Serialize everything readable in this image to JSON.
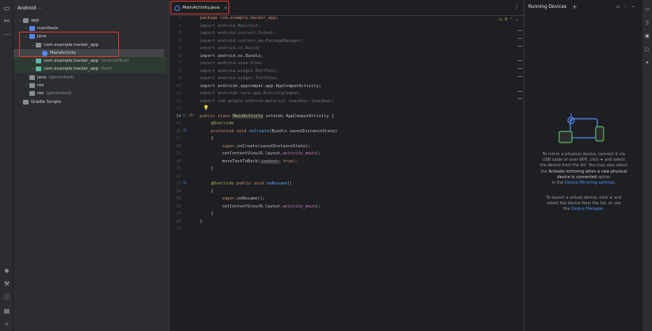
{
  "project_panel": {
    "view_label": "Android",
    "tree": [
      {
        "label": "app",
        "suffix": ""
      },
      {
        "label": "manifests",
        "suffix": ""
      },
      {
        "label": "java",
        "suffix": ""
      },
      {
        "label": "com.example.hacker_app",
        "suffix": ""
      },
      {
        "label": "MainActivity",
        "suffix": ""
      },
      {
        "label": "com.example.hacker_app",
        "suffix": "(androidTest)"
      },
      {
        "label": "com.example.hacker_app",
        "suffix": "(test)"
      },
      {
        "label": "java",
        "suffix": "(generated)"
      },
      {
        "label": "res",
        "suffix": ""
      },
      {
        "label": "res",
        "suffix": "(generated)"
      },
      {
        "label": "Gradle Scripts",
        "suffix": ""
      }
    ]
  },
  "editor": {
    "tab_label": "MainActivity.java",
    "warning_count": "9",
    "line_numbers": [
      "1",
      "2",
      "3",
      "4",
      "5",
      "6",
      "7",
      "8",
      "9",
      "10",
      "11",
      "12",
      "13",
      "14",
      "15",
      "16",
      "17",
      "18",
      "19",
      "20",
      "21",
      "22",
      "23",
      "24",
      "25",
      "26",
      "27",
      "28",
      "29"
    ],
    "lines": {
      "l1": "package com.example.hacker_app;",
      "l2": "import android.Manifest;",
      "l3": "import android.content.Intent;",
      "l4": "import android.content.pm.PackageManager;",
      "l5": "import android.os.Build;",
      "l6": "import android.os.Bundle;",
      "l7": "import android.view.View;",
      "l8": "import android.widget.EditText;",
      "l9": "import android.widget.TextView;",
      "l10": "import androidx.appcompat.app.AppCompatActivity;",
      "l11": "import androidx.core.app.ActivityCompat;",
      "l12": "import com.google.android.material.snackbar.Snackbar;",
      "l14a": "public class ",
      "l14b": "MainActivity",
      "l14c": " extends AppCompatActivity {",
      "l15": "@Override",
      "l16a": "protected void ",
      "l16b": "onCreate",
      "l16c": "(Bundle savedInstanceState)",
      "l17": "{",
      "l18a": "super",
      "l18b": ".onCreate(savedInstanceState);",
      "l19a": "setContentView(R.layout.",
      "l19b": "activity_main",
      "l19c": ");",
      "l20a": "moveTaskToBack(",
      "l20hint": "nonRoot:",
      "l20b": " true);",
      "l21": "}",
      "l23a": "@Override",
      "l23b": " public void ",
      "l23c": "onResume",
      "l23d": "()",
      "l24": "{",
      "l25a": "super",
      "l25b": ".onResume();",
      "l26a": "setContentView(R.layout.",
      "l26b": "activity_main",
      "l26c": ");",
      "l27": "}",
      "l28": "}"
    }
  },
  "devices_panel": {
    "title": "Running Devices",
    "para1_a": "To mirror a physical device, connect it via",
    "para1_b": "USB cable or over WiFi, click",
    "para1_c": "and select",
    "para1_d": "the device from the list. You may also select",
    "para1_e": "the",
    "para1_f": "Activate mirroring when a new physical",
    "para1_g": "device is connected",
    "para1_h": "option",
    "para1_i": "in the",
    "para1_link": "Device Mirroring settings",
    "para2_a": "To launch a virtual device, click",
    "para2_b": "and",
    "para2_c": "select the device from the list, or use",
    "para2_d": "the",
    "para2_link": "Device Manager"
  },
  "icons": {
    "left_rail": [
      "folder-icon",
      "structure-icon",
      "more-icon",
      "gemini-icon",
      "build-icon",
      "problems-icon",
      "terminal-icon",
      "git-icon"
    ],
    "right_rail": [
      "notifications-icon",
      "devices-icon",
      "device-manager-icon",
      "emulator-icon",
      "gemini-icon"
    ]
  },
  "colors": {
    "highlight": "#e53935",
    "accent": "#548af7",
    "keyword": "#cf8e6d",
    "function": "#56a8f5",
    "field": "#c77dbb",
    "annotation": "#b3ae60"
  }
}
